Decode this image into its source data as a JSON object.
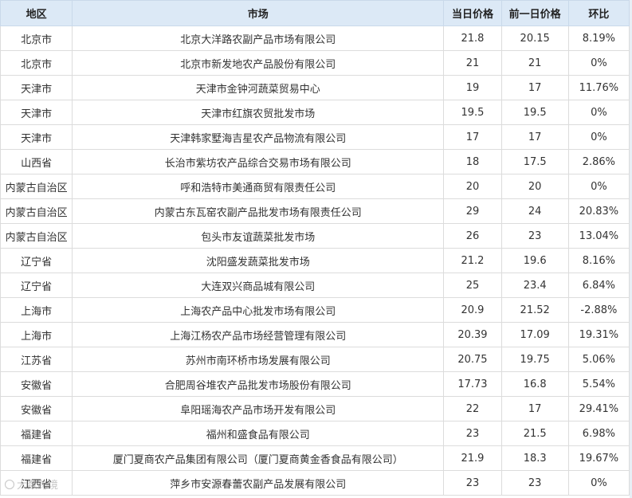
{
  "table": {
    "headers": [
      "地区",
      "市场",
      "当日价格",
      "前一日价格",
      "环比"
    ],
    "rows": [
      [
        "北京市",
        "北京大洋路农副产品市场有限公司",
        "21.8",
        "20.15",
        "8.19%"
      ],
      [
        "北京市",
        "北京市新发地农产品股份有限公司",
        "21",
        "21",
        "0%"
      ],
      [
        "天津市",
        "天津市金钟河蔬菜贸易中心",
        "19",
        "17",
        "11.76%"
      ],
      [
        "天津市",
        "天津市红旗农贸批发市场",
        "19.5",
        "19.5",
        "0%"
      ],
      [
        "天津市",
        "天津韩家墅海吉星农产品物流有限公司",
        "17",
        "17",
        "0%"
      ],
      [
        "山西省",
        "长治市紫坊农产品综合交易市场有限公司",
        "18",
        "17.5",
        "2.86%"
      ],
      [
        "内蒙古自治区",
        "呼和浩特市美通商贸有限责任公司",
        "20",
        "20",
        "0%"
      ],
      [
        "内蒙古自治区",
        "内蒙古东瓦窑农副产品批发市场有限责任公司",
        "29",
        "24",
        "20.83%"
      ],
      [
        "内蒙古自治区",
        "包头市友谊蔬菜批发市场",
        "26",
        "23",
        "13.04%"
      ],
      [
        "辽宁省",
        "沈阳盛发蔬菜批发市场",
        "21.2",
        "19.6",
        "8.16%"
      ],
      [
        "辽宁省",
        "大连双兴商品城有限公司",
        "25",
        "23.4",
        "6.84%"
      ],
      [
        "上海市",
        "上海农产品中心批发市场有限公司",
        "20.9",
        "21.52",
        "-2.88%"
      ],
      [
        "上海市",
        "上海江杨农产品市场经营管理有限公司",
        "20.39",
        "17.09",
        "19.31%"
      ],
      [
        "江苏省",
        "苏州市南环桥市场发展有限公司",
        "20.75",
        "19.75",
        "5.06%"
      ],
      [
        "安徽省",
        "合肥周谷堆农产品批发市场股份有限公司",
        "17.73",
        "16.8",
        "5.54%"
      ],
      [
        "安徽省",
        "阜阳瑶海农产品市场开发有限公司",
        "22",
        "17",
        "29.41%"
      ],
      [
        "福建省",
        "福州和盛食品有限公司",
        "23",
        "21.5",
        "6.98%"
      ],
      [
        "福建省",
        "厦门夏商农产品集团有限公司（厦门夏商黄金香食品有限公司）",
        "21.9",
        "18.3",
        "19.67%"
      ],
      [
        "江西省",
        "萍乡市安源春蕾农副产品发展有限公司",
        "23",
        "23",
        "0%"
      ]
    ]
  },
  "watermark": {
    "text": "大数跨境"
  },
  "colors": {
    "header_bg": "#dce9f6",
    "border": "#dcdcdc",
    "text": "#333333"
  }
}
